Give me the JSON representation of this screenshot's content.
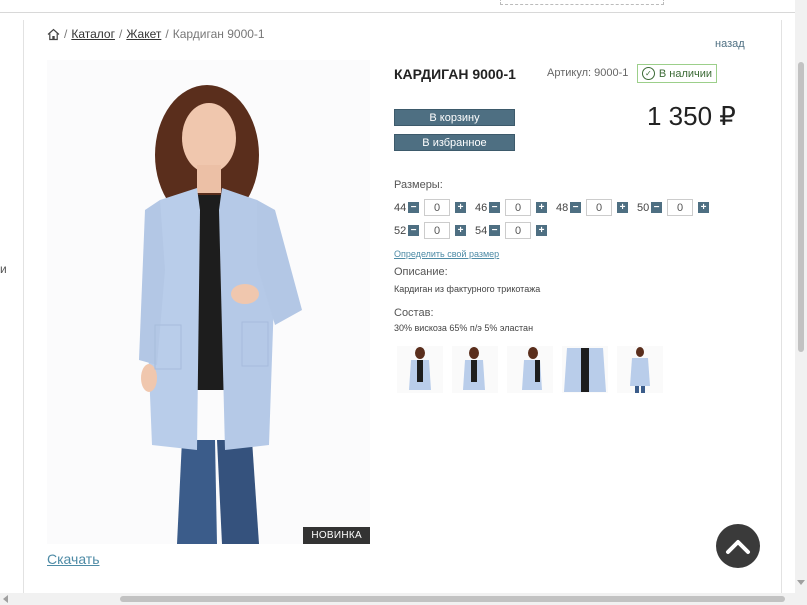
{
  "breadcrumb": {
    "home_icon": "home-icon",
    "items": [
      "Каталог",
      "Жакет"
    ],
    "current": "Кардиган 9000-1"
  },
  "back_link": "назад",
  "product": {
    "title": "КАРДИГАН 9000-1",
    "sku": "Артикул: 9000-1",
    "stock": "В наличии",
    "price": "1 350 ₽",
    "badge": "НОВИНКА",
    "download": "Скачать"
  },
  "actions": {
    "cart": "В корзину",
    "favorite": "В избранное"
  },
  "sizes": {
    "label": "Размеры:",
    "items": [
      {
        "size": "44",
        "qty": "0"
      },
      {
        "size": "46",
        "qty": "0"
      },
      {
        "size": "48",
        "qty": "0"
      },
      {
        "size": "50",
        "qty": "0"
      },
      {
        "size": "52",
        "qty": "0"
      },
      {
        "size": "54",
        "qty": "0"
      }
    ],
    "link": "Определить свой размер"
  },
  "description": {
    "label": "Описание:",
    "text": "Кардиган из фактурного трикотажа"
  },
  "composition": {
    "label": "Состав:",
    "text": "30% вискоза 65% п/э 5% эластан"
  },
  "colors": {
    "accent": "#4e6f82",
    "stock_border": "#9ccf8a",
    "garment": "#b9cdea"
  },
  "left_edge_text": "и"
}
